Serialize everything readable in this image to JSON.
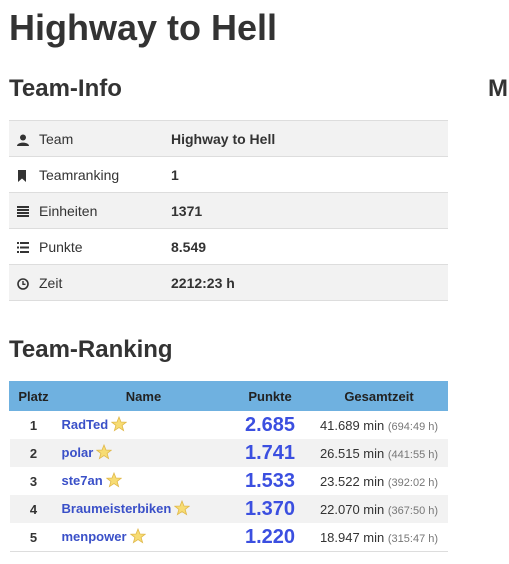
{
  "page_title": "Highway to Hell",
  "team_info": {
    "title": "Team-Info",
    "rows": [
      {
        "icon": "user-icon",
        "label": "Team",
        "value": "Highway to Hell"
      },
      {
        "icon": "bookmark-icon",
        "label": "Teamranking",
        "value": "1"
      },
      {
        "icon": "list-icon",
        "label": "Einheiten",
        "value": "1371"
      },
      {
        "icon": "list-bullets-icon",
        "label": "Punkte",
        "value": "8.549"
      },
      {
        "icon": "clock-icon",
        "label": "Zeit",
        "value": "2212:23 h"
      }
    ]
  },
  "cut_section_title": "M",
  "team_ranking": {
    "title": "Team-Ranking",
    "headers": {
      "platz": "Platz",
      "name": "Name",
      "punkte": "Punkte",
      "zeit": "Gesamtzeit"
    },
    "rows": [
      {
        "platz": "1",
        "name": "RadTed",
        "punkte": "2.685",
        "zeit": "41.689 min",
        "zeit_h": "(694:49 h)"
      },
      {
        "platz": "2",
        "name": "polar",
        "punkte": "1.741",
        "zeit": "26.515 min",
        "zeit_h": "(441:55 h)"
      },
      {
        "platz": "3",
        "name": "ste7an",
        "punkte": "1.533",
        "zeit": "23.522 min",
        "zeit_h": "(392:02 h)"
      },
      {
        "platz": "4",
        "name": "Braumeisterbiken",
        "punkte": "1.370",
        "zeit": "22.070 min",
        "zeit_h": "(367:50 h)"
      },
      {
        "platz": "5",
        "name": "menpower",
        "punkte": "1.220",
        "zeit": "18.947 min",
        "zeit_h": "(315:47 h)"
      }
    ]
  },
  "colors": {
    "header_bg": "#6fb1e0",
    "link": "#3a50c8",
    "points": "#3b4fe0",
    "star": "#f5d35a"
  }
}
